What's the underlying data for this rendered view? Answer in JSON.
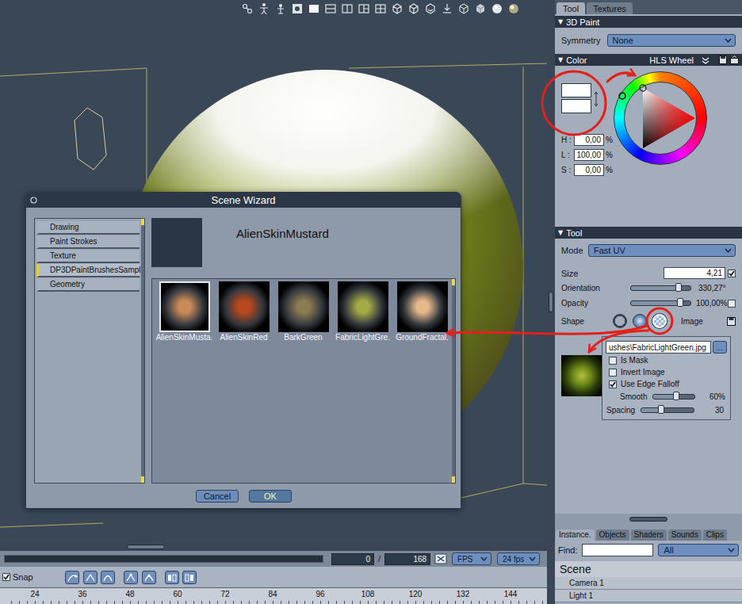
{
  "timeline": {
    "current_frame": "0",
    "separator": "/",
    "end_frame": "168",
    "time_mode": "FPS",
    "frame_rate": "24 fps",
    "snap": {
      "label": "Snap",
      "checked": true
    },
    "ruler": [
      "24",
      "36",
      "48",
      "60",
      "72",
      "84",
      "96",
      "108",
      "120",
      "132",
      "144"
    ]
  },
  "dialog": {
    "title": "Scene Wizard",
    "categories": [
      {
        "label": "Drawing",
        "selected": false
      },
      {
        "label": "Paint Strokes",
        "selected": false
      },
      {
        "label": "Texture",
        "selected": false
      },
      {
        "label": "DP3DPaintBrushesSampl",
        "selected": true
      },
      {
        "label": "Geometry",
        "selected": false
      }
    ],
    "preview_title": "AlienSkinMustard",
    "items": [
      {
        "label": "AlienSkinMusta.",
        "selected": true,
        "color": "#c98a5a"
      },
      {
        "label": "AlienSkinRed",
        "selected": false,
        "color": "#b8481c"
      },
      {
        "label": "BarkGreen",
        "selected": false,
        "color": "#8c7c52"
      },
      {
        "label": "FabricLightGre.",
        "selected": false,
        "color": "#a4aa44"
      },
      {
        "label": "GroundFractal.",
        "selected": false,
        "color": "#e6b88a"
      }
    ],
    "buttons": [
      {
        "label": "Cancel",
        "default": false
      },
      {
        "label": "OK",
        "default": true
      }
    ]
  },
  "tool_panel": {
    "tabs": [
      {
        "label": "Tool",
        "selected": true
      },
      {
        "label": "Textures",
        "selected": false
      }
    ],
    "paint_section": {
      "toggle": "▼",
      "title": "3D Paint",
      "expanded": true,
      "symmetry_label": "Symmetry",
      "symmetry_value": "None"
    },
    "color_section": {
      "toggle": "▼",
      "title": "Color",
      "expanded": true,
      "picker": "HLS Wheel",
      "foreground": "#ffffff",
      "background": "#ffffff",
      "fields": [
        {
          "label": "H :",
          "value": "0,00",
          "unit": "%"
        },
        {
          "label": "L :",
          "value": "100,00",
          "unit": "%"
        },
        {
          "label": "S :",
          "value": "0,00",
          "unit": "%"
        }
      ]
    },
    "tool_section": {
      "toggle": "▼",
      "title": "Tool",
      "expanded": true,
      "mode_label": "Mode",
      "mode_value": "Fast UV",
      "size": {
        "label": "Size",
        "value": "4,21",
        "checked": true
      },
      "orientation": {
        "label": "Orientation",
        "value": "330,27°",
        "level": 0.8
      },
      "opacity": {
        "label": "Opacity",
        "value": "100,00%",
        "level": 0.82,
        "checked": false
      },
      "shape": {
        "label": "Shape",
        "options": [
          {
            "kind": "hard",
            "selected": false
          },
          {
            "kind": "soft",
            "selected": false
          },
          {
            "kind": "image",
            "selected": true
          }
        ],
        "option_label": "Image"
      },
      "image": {
        "path": "ushes\\FabricLightGreen.jpg",
        "browse": "...",
        "options": [
          {
            "label": "Is Mask",
            "checked": false
          },
          {
            "label": "Invert Image",
            "checked": false
          },
          {
            "label": "Use Edge Falloff",
            "checked": true
          }
        ],
        "smooth": {
          "label": "Smooth",
          "value": "60%",
          "level": 0.55
        },
        "spacing": {
          "label": "Spacing",
          "value": "30",
          "level": 0.38
        }
      }
    }
  },
  "scene_panel": {
    "tabs": [
      {
        "label": "Instance.",
        "selected": true
      },
      {
        "label": "Objects",
        "selected": false
      },
      {
        "label": "Shaders",
        "selected": false
      },
      {
        "label": "Sounds",
        "selected": false
      },
      {
        "label": "Clips",
        "selected": false
      }
    ],
    "find_label": "Find:",
    "find_value": "",
    "filter": "All",
    "title": "Scene",
    "items": [
      "Camera 1",
      "Light 1"
    ]
  }
}
